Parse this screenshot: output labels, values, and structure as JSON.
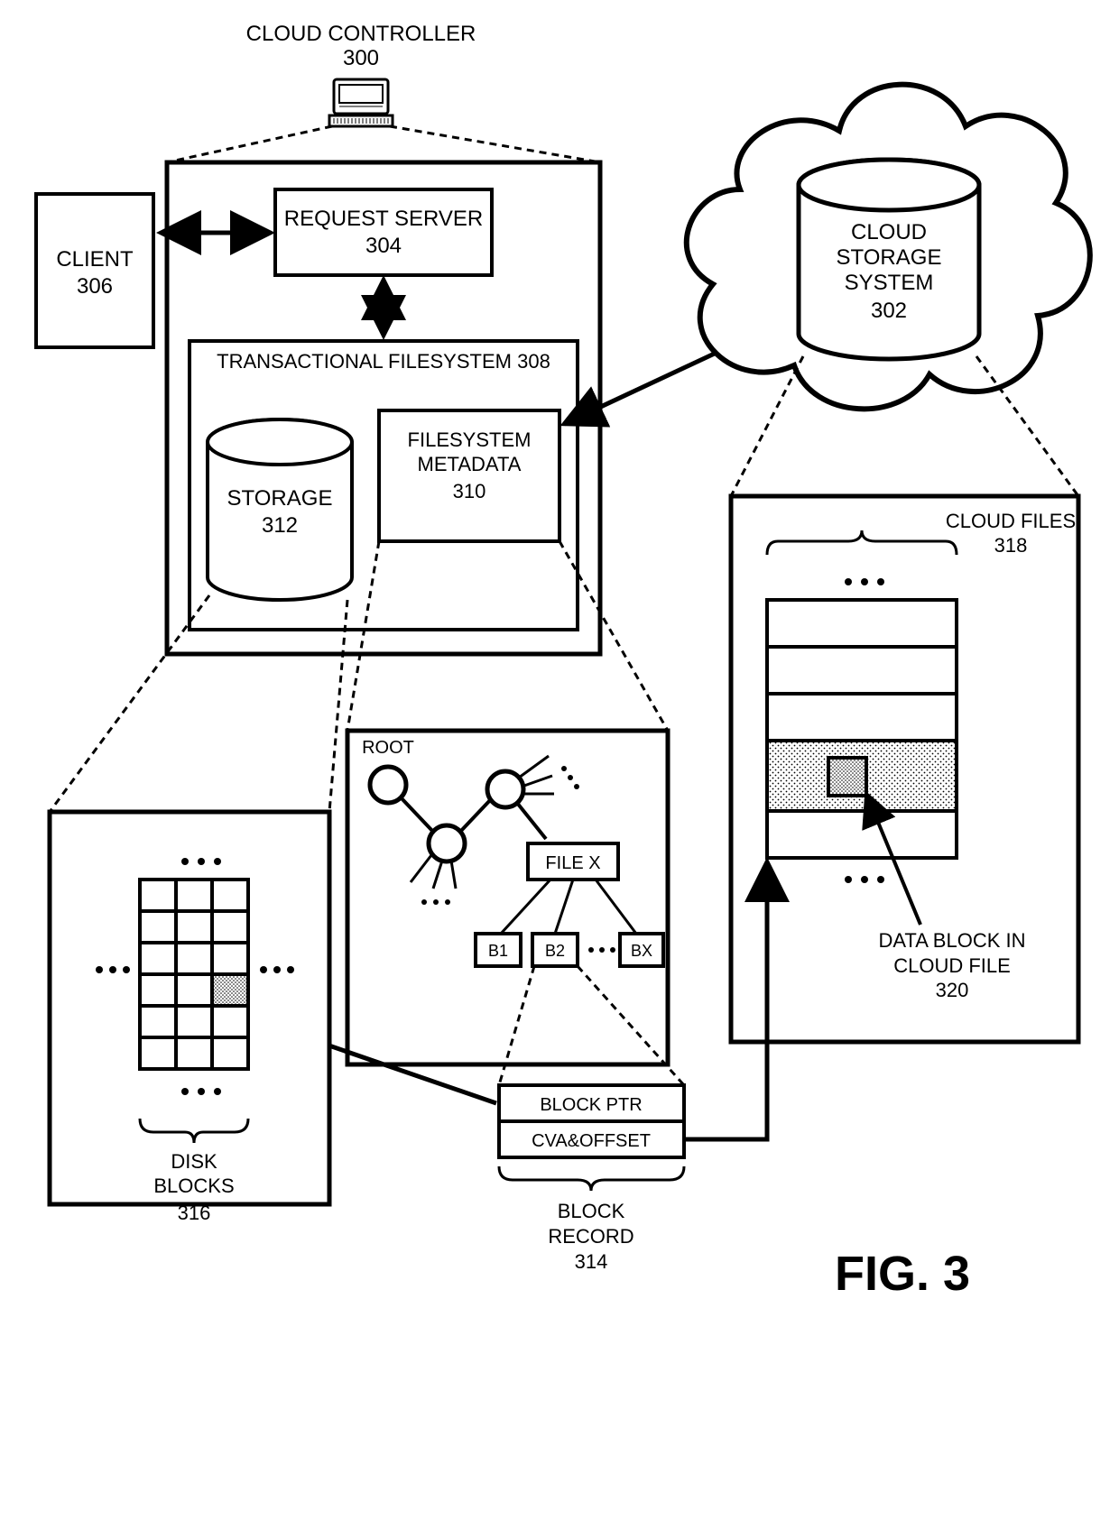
{
  "figure_label": "FIG. 3",
  "components": {
    "cloud_controller": {
      "label": "CLOUD CONTROLLER",
      "ref": "300"
    },
    "client": {
      "label": "CLIENT",
      "ref": "306"
    },
    "request_server": {
      "label": "REQUEST SERVER",
      "ref": "304"
    },
    "transactional_fs": {
      "label": "TRANSACTIONAL FILESYSTEM",
      "ref": "308"
    },
    "storage": {
      "label": "STORAGE",
      "ref": "312"
    },
    "filesystem_metadata": {
      "label": "FILESYSTEM METADATA",
      "ref": "310"
    },
    "cloud_storage": {
      "label": "CLOUD STORAGE SYSTEM",
      "ref": "302"
    },
    "disk_blocks": {
      "label": "DISK BLOCKS",
      "ref": "316"
    },
    "block_record": {
      "label": "BLOCK RECORD",
      "ref": "314"
    },
    "cloud_files": {
      "label": "CLOUD FILES",
      "ref": "318"
    },
    "data_block_in_cloud": {
      "label": "DATA BLOCK IN CLOUD FILE",
      "ref": "320"
    }
  },
  "tree": {
    "root": "ROOT",
    "file": "FILE X",
    "blocks": [
      "B1",
      "B2",
      "BX"
    ],
    "ellipsis": "···"
  },
  "block_record_fields": {
    "top": "BLOCK PTR",
    "bottom": "CVA&OFFSET"
  },
  "ellipsis": "···"
}
